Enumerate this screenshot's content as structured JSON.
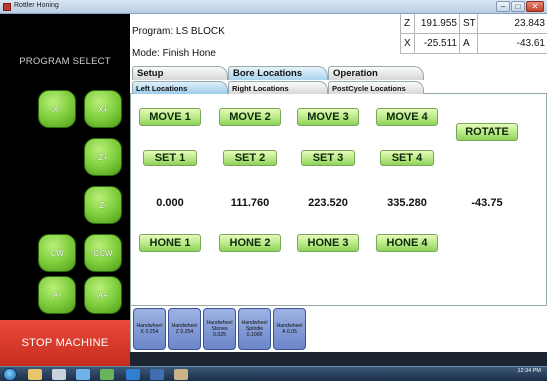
{
  "window": {
    "title": "Rottler Honing"
  },
  "left_panel": {
    "program_select_label": "PROGRAM SELECT",
    "jog_buttons": [
      "X-",
      "X+",
      "Z+",
      "Z-",
      "CW",
      "CCW",
      "A-",
      "A+"
    ],
    "stop_label": "STOP MACHINE"
  },
  "header": {
    "program_line": "Program: LS BLOCK",
    "mode_line": "Mode: Finish Hone",
    "coords": {
      "z_label": "Z",
      "z_value": "191.955",
      "st_label": "ST",
      "st_value": "23.843",
      "x_label": "X",
      "x_value": "-25.511",
      "a_label": "A",
      "a_value": "-43.61"
    }
  },
  "tabs_main": [
    "Setup",
    "Bore Locations",
    "Operation"
  ],
  "tabs_main_active": "Bore Locations",
  "tabs_sub": [
    "Left Locations",
    "Right Locations",
    "PostCycle Locations"
  ],
  "tabs_sub_active": "Left Locations",
  "bore_locations": {
    "move_labels": [
      "MOVE 1",
      "MOVE 2",
      "MOVE 3",
      "MOVE 4"
    ],
    "rotate_label": "ROTATE",
    "set_labels": [
      "SET 1",
      "SET 2",
      "SET 3",
      "SET 4"
    ],
    "positions": [
      "0.000",
      "111.760",
      "223.520",
      "335.280"
    ],
    "rotate_value": "-43.75",
    "hone_labels": [
      "HONE 1",
      "HONE 2",
      "HONE 3",
      "HONE 4"
    ]
  },
  "handwheels": [
    "Handwheel X 0.254",
    "Handwheel Z 0.254",
    "Handwheel Stones 0.025",
    "Handwheel Spindle 0.1000",
    "Handwheel A 0.05"
  ],
  "taskbar": {
    "time": "12:34 PM"
  },
  "colors": {
    "accent_green": "#8fd157",
    "stop_red": "#e94b3c",
    "handwheel_blue": "#6b85c8",
    "active_tab": "#a9d4ee"
  }
}
